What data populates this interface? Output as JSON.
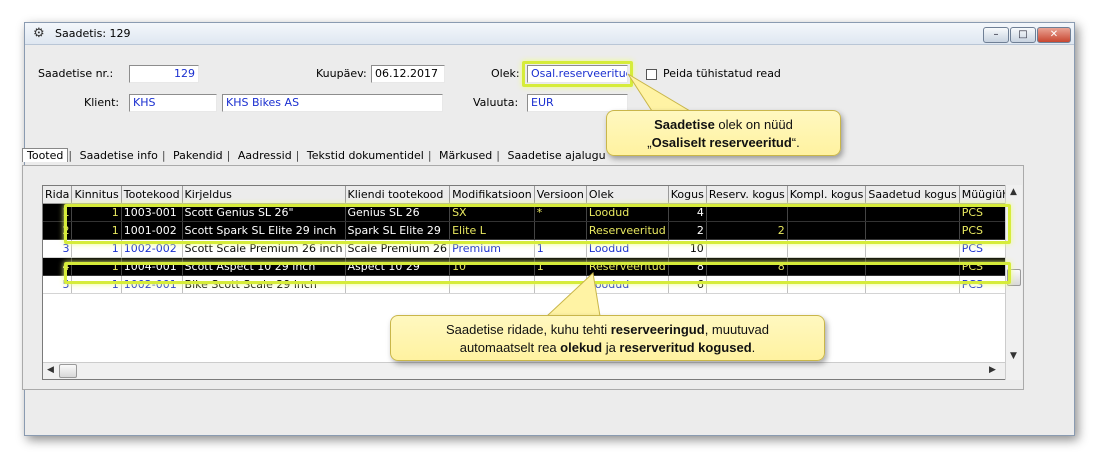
{
  "window": {
    "title": "Saadetis: 129",
    "icon": "gear-icon",
    "controls": {
      "minimize": "–",
      "maximize": "□",
      "close": "✕"
    }
  },
  "form": {
    "shipment_no_label": "Saadetise nr.:",
    "shipment_no_value": "129",
    "date_label": "Kuupäev:",
    "date_value": "06.12.2017",
    "status_label": "Olek:",
    "status_value": "Osal.reserveeritud",
    "hide_cancelled_label": "Peida tühistatud read",
    "client_label": "Klient:",
    "client_code": "KHS",
    "client_name": "KHS Bikes AS",
    "currency_label": "Valuuta:",
    "currency_value": "EUR"
  },
  "tabs": [
    "Tooted",
    "Saadetise info",
    "Pakendid",
    "Aadressid",
    "Tekstid dokumentidel",
    "Märkused",
    "Saadetise ajalugu"
  ],
  "table": {
    "columns": [
      "Rida",
      "Kinnitus",
      "Tootekood",
      "Kirjeldus",
      "Kliendi tootekood",
      "Modifikatsioon",
      "Versioon",
      "Olek",
      "Kogus",
      "Reserv. kogus",
      "Kompl. kogus",
      "Saadetud kogus",
      "Müügiühik"
    ],
    "rows": [
      {
        "rida": "1",
        "kinnitus": "1",
        "kood": "1003-001",
        "kirjeldus": "Scott Genius SL 26\"",
        "kliendi": "Genius SL 26",
        "mod": "SX",
        "ver": "*",
        "olek": "Loodud",
        "kogus": "4",
        "reserv": "",
        "kompl": "",
        "saadetud": "",
        "yhik": "PCS"
      },
      {
        "rida": "2",
        "kinnitus": "1",
        "kood": "1001-002",
        "kirjeldus": "Scott Spark SL Elite 29 inch",
        "kliendi": "Spark SL Elite 29",
        "mod": "Elite L",
        "ver": "",
        "olek": "Reserveeritud",
        "kogus": "2",
        "reserv": "2",
        "kompl": "",
        "saadetud": "",
        "yhik": "PCS"
      },
      {
        "rida": "3",
        "kinnitus": "1",
        "kood": "1002-002",
        "kirjeldus": "Scott Scale Premium 26 inch",
        "kliendi": "Scale Premium 26",
        "mod": "Premium",
        "ver": "1",
        "olek": "Loodud",
        "kogus": "10",
        "reserv": "",
        "kompl": "",
        "saadetud": "",
        "yhik": "PCS"
      },
      {
        "rida": "4",
        "kinnitus": "1",
        "kood": "1004-001",
        "kirjeldus": "Scott Aspect 10 29 inch",
        "kliendi": "Aspect 10 29",
        "mod": "10",
        "ver": "1",
        "olek": "Reserveeritud",
        "kogus": "8",
        "reserv": "8",
        "kompl": "",
        "saadetud": "",
        "yhik": "PCS"
      },
      {
        "rida": "5",
        "kinnitus": "1",
        "kood": "1002-001",
        "kirjeldus": "Bike Scott Scale 29 inch",
        "kliendi": "",
        "mod": "",
        "ver": "",
        "olek": "Loodud",
        "kogus": "6",
        "reserv": "",
        "kompl": "",
        "saadetud": "",
        "yhik": "PCS"
      }
    ]
  },
  "callouts": {
    "status": {
      "pre": "",
      "b1": "Saadetise",
      "mid": " olek on nüüd",
      "line2_pre": "„",
      "b2": "Osaliselt reserveeritud",
      "line2_post": "“."
    },
    "rows": {
      "line1_pre": "Saadetise ridade, kuhu tehti ",
      "b1": "reserveeringud",
      "line1_post": ", muutuvad",
      "line2_pre": "automaatselt rea ",
      "b2": "olekud",
      "line2_mid": " ja ",
      "b3": "reserveritud kogused",
      "line2_post": "."
    }
  },
  "colors": {
    "highlight": "#d6ec3a",
    "callout_bg": "#fff4a8",
    "field_blue": "#1a2fd0",
    "dark_row_text": "#e8e860"
  }
}
